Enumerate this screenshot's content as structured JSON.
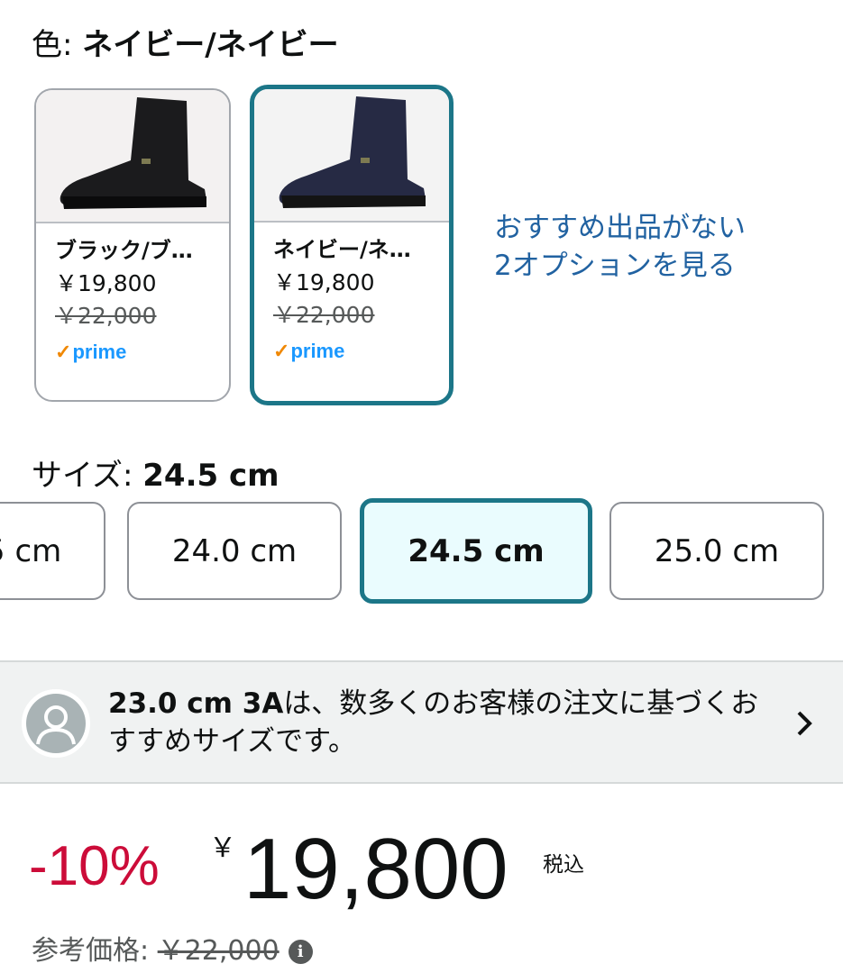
{
  "color": {
    "label": "色: ",
    "value": "ネイビー/ネイビー"
  },
  "swatches": [
    {
      "name": "ブラック/ブ…",
      "price": "￥19,800",
      "list_price": "￥22,000",
      "badge": "prime",
      "shoe_color": "#1b1b1d"
    },
    {
      "name": "ネイビー/ネ…",
      "price": "￥19,800",
      "list_price": "￥22,000",
      "badge": "prime",
      "shoe_color": "#262a44"
    }
  ],
  "offers_link": {
    "line1": "おすすめ出品がない",
    "line2": "2オプションを見る"
  },
  "size": {
    "label": "サイズ: ",
    "value": "24.5 cm"
  },
  "size_options": [
    "5 cm",
    "24.0 cm",
    "24.5 cm",
    "25.0 cm"
  ],
  "recommendation": {
    "bold": "23.0 cm 3A",
    "text": "は、数多くのお客様の注文に基づくおすすめサイズです。"
  },
  "price": {
    "discount": "-10%",
    "currency": "￥",
    "amount": "19,800",
    "tax_note": "税込"
  },
  "reference": {
    "label": "参考価格: ",
    "value": "￥22,000"
  },
  "colors": {
    "accent": "#1c7688",
    "link": "#2162a1",
    "discount": "#cc0c39",
    "prime": "#1a98ff",
    "check": "#f08804"
  }
}
